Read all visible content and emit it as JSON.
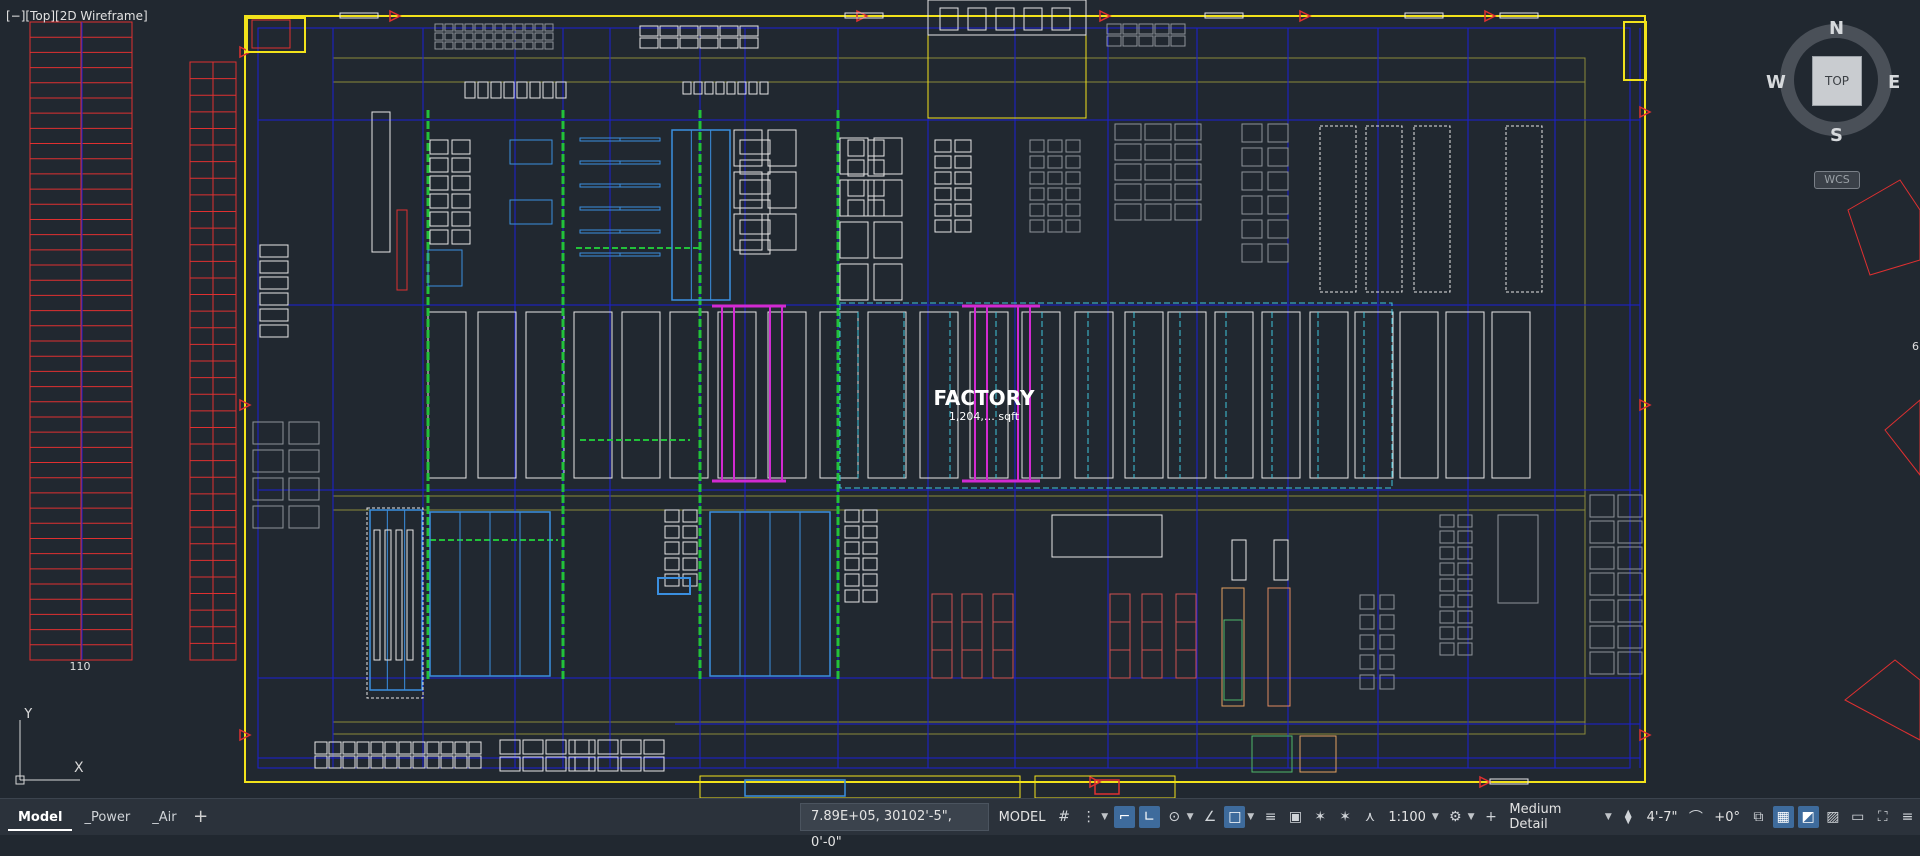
{
  "viewport": {
    "label": "[−][Top][2D Wireframe]",
    "parking_label": "110",
    "edge_label": "6"
  },
  "drawing": {
    "factory_title": "FACTORY",
    "factory_area": "1,204,… sqft",
    "colors": {
      "background": "#212830",
      "boundary": "#f2e21b",
      "grid": "#1a1fd6",
      "frames": "#e6e6e6",
      "parking": "#e03030",
      "racks": "#3a8fe0",
      "magenta": "#d22ad2",
      "green": "#22c23a",
      "cyan": "#3ec6dc",
      "olive": "#8a8a3a"
    }
  },
  "viewcube": {
    "top": "TOP",
    "north": "N",
    "south": "S",
    "east": "E",
    "west": "W",
    "wcs": "WCS"
  },
  "ucs": {
    "x": "X",
    "y": "Y"
  },
  "statusbar": {
    "tabs": [
      {
        "label": "Model",
        "active": true
      },
      {
        "label": "_Power",
        "active": false
      },
      {
        "label": "_Air",
        "active": false
      }
    ],
    "add_tab": "+",
    "coordinates": "7.89E+05, 30102'-5\", 0'-0\"",
    "mode": "MODEL",
    "scale": "1:100",
    "detail": "Medium Detail",
    "elevation": "4'-7\"",
    "angle": "+0°"
  }
}
